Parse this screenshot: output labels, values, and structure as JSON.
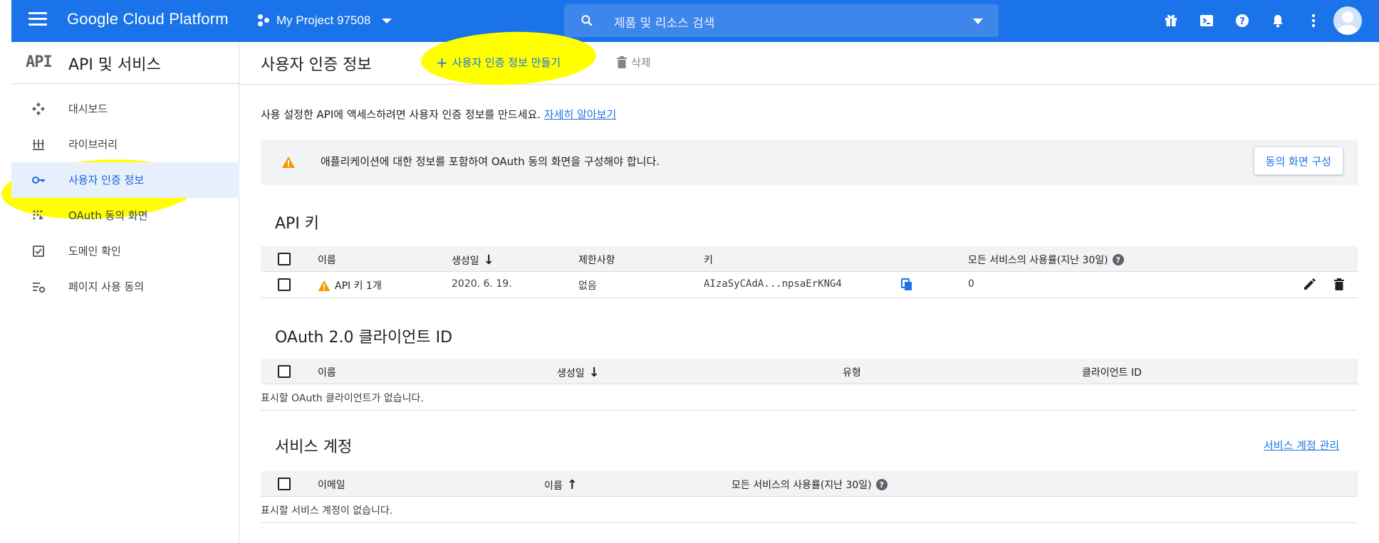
{
  "topbar": {
    "brand": "Google Cloud Platform",
    "project": "My Project 97508",
    "search_placeholder": "제품 및 리소스 검색",
    "bg_color": "#1a73e8"
  },
  "sidebar": {
    "logo": "API",
    "title": "API 및 서비스",
    "items": [
      {
        "label": "대시보드",
        "icon": "dashboard-icon"
      },
      {
        "label": "라이브러리",
        "icon": "library-icon"
      },
      {
        "label": "사용자 인증 정보",
        "icon": "key-icon",
        "active": true
      },
      {
        "label": "OAuth 동의 화면",
        "icon": "oauth-icon"
      },
      {
        "label": "도메인 확인",
        "icon": "checkbox-icon"
      },
      {
        "label": "페이지 사용 동의",
        "icon": "settings-list-icon"
      }
    ]
  },
  "header": {
    "title": "사용자 인증 정보",
    "create_label": "사용자 인증 정보 만들기",
    "delete_label": "삭제"
  },
  "main": {
    "intro_text": "사용 설정한 API에 액세스하려면 사용자 인증 정보를 만드세요.",
    "intro_link": "자세히 알아보기",
    "notice_text": "애플리케이션에 대한 정보를 포함하여 OAuth 동의 화면을 구성해야 합니다.",
    "notice_button": "동의 화면 구성"
  },
  "api_keys": {
    "title": "API 키",
    "columns": [
      "이름",
      "생성일",
      "제한사항",
      "키",
      "모든 서비스의 사용률(지난 30일)"
    ],
    "rows": [
      {
        "name": "API 키 1개",
        "created": "2020. 6. 19.",
        "restriction": "없음",
        "key": "AIzaSyCAdA...npsaErKNG4",
        "usage": "0"
      }
    ]
  },
  "oauth": {
    "title": "OAuth 2.0 클라이언트 ID",
    "columns": [
      "이름",
      "생성일",
      "유형",
      "클라이언트 ID"
    ],
    "empty": "표시할 OAuth 클라이언트가 없습니다."
  },
  "service_accounts": {
    "title": "서비스 계정",
    "manage_link": "서비스 계정 관리",
    "columns": [
      "이메일",
      "이름",
      "모든 서비스의 사용률(지난 30일)"
    ],
    "empty": "표시할 서비스 계정이 없습니다."
  }
}
